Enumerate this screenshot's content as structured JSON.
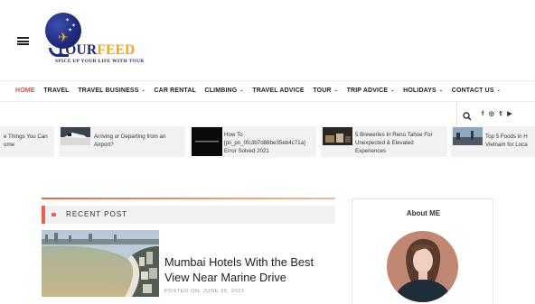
{
  "header": {
    "logo": {
      "title_part1": "TOURFEED",
      "tagline": "SPICE UP YOUR LIFE WITH TOUR"
    },
    "menu_icon": "hamburger-icon"
  },
  "nav": {
    "items": [
      {
        "label": "HOME",
        "active": true,
        "dropdown": false
      },
      {
        "label": "TRAVEL",
        "active": false,
        "dropdown": false
      },
      {
        "label": "TRAVEL BUSINESS",
        "active": false,
        "dropdown": true
      },
      {
        "label": "CAR RENTAL",
        "active": false,
        "dropdown": false
      },
      {
        "label": "CLIMBING",
        "active": false,
        "dropdown": true
      },
      {
        "label": "TRAVEL ADVICE",
        "active": false,
        "dropdown": false
      },
      {
        "label": "TOUR",
        "active": false,
        "dropdown": true
      },
      {
        "label": "TRIP ADVICE",
        "active": false,
        "dropdown": true
      },
      {
        "label": "HOLIDAYS",
        "active": false,
        "dropdown": true
      },
      {
        "label": "CONTACT US",
        "active": false,
        "dropdown": true
      }
    ],
    "chevron": "⌄"
  },
  "utility": {
    "search_icon": "search-icon",
    "socials": [
      {
        "icon": "facebook-icon",
        "glyph": "f"
      },
      {
        "icon": "instagram-icon",
        "glyph": "◎"
      },
      {
        "icon": "twitter-icon",
        "glyph": "𝕥"
      },
      {
        "icon": "youtube-icon",
        "glyph": "▶"
      }
    ]
  },
  "ticker": {
    "items": [
      {
        "line1": "e Things You Can",
        "line2": "ume"
      },
      {
        "line1": "Arriving or Departing from an",
        "line2": "Airport?"
      },
      {
        "line1": "How To",
        "line2": "[pii_pn_0fc3b7d88be35eb4c71a]",
        "line3": "Error Solved 2021"
      },
      {
        "line1": "5 Breweries In Reno Tahoe For",
        "line2": "Unexpected & Elevated",
        "line3": "Experiences"
      },
      {
        "line1": "Top 5 Foods in H",
        "line2": "Vietnam for Loca"
      }
    ]
  },
  "main": {
    "section_label": "RECENT POST",
    "post": {
      "title": "Mumbai Hotels With the Best View Near Marine Drive",
      "date": "POSTED ON: JUNE 26, 2021"
    }
  },
  "sidebar": {
    "about_title": "About ME"
  },
  "colors": {
    "accent": "#e14a3b",
    "brand_navy": "#1f2a78",
    "brand_orange": "#f3a51b"
  }
}
